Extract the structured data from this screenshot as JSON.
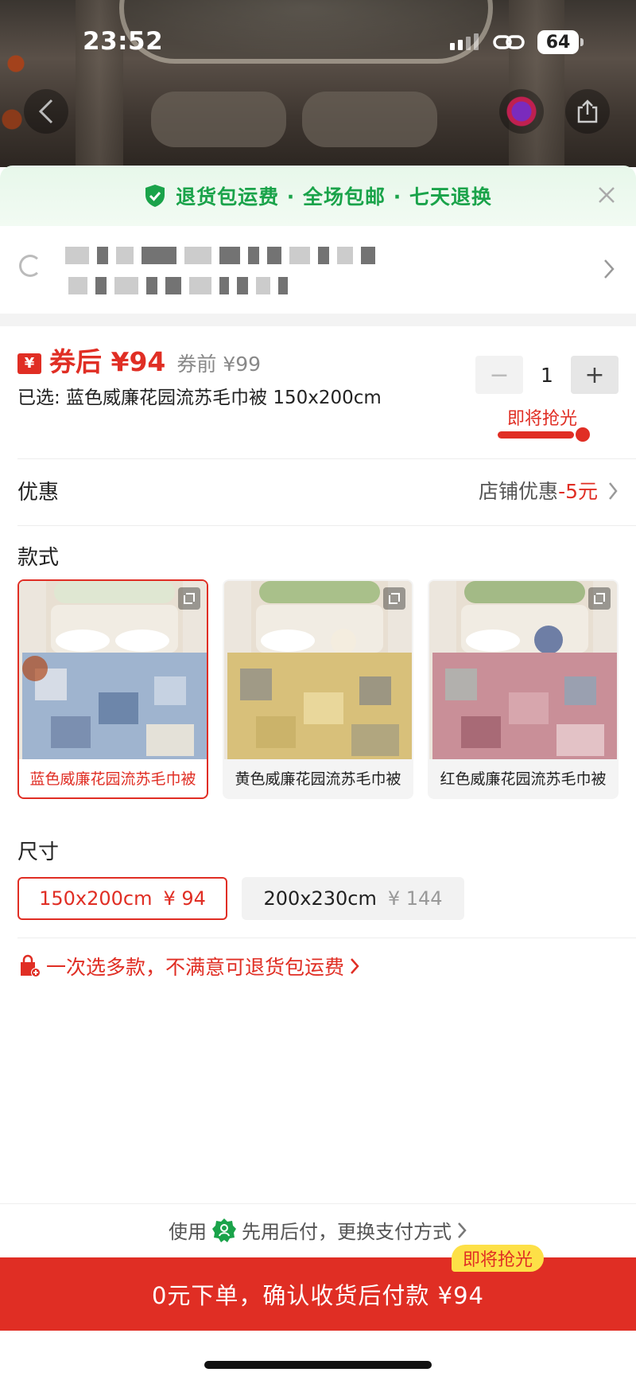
{
  "status_bar": {
    "time": "23:52",
    "battery": "64"
  },
  "banner": {
    "text": "退货包运费 · 全场包邮 · 七天退换"
  },
  "price": {
    "coupon_tag": "¥",
    "after_coupon": "券后 ¥94",
    "before_coupon": "券前 ¥99",
    "selected": "已选: 蓝色威廉花园流苏毛巾被 150x200cm"
  },
  "stepper": {
    "minus": "−",
    "value": "1",
    "plus": "+"
  },
  "stock": {
    "label": "即将抢光",
    "remaining_fraction": 0.8
  },
  "discount": {
    "label": "优惠",
    "shop_label": "店铺优惠",
    "amount": "-5元"
  },
  "style": {
    "title": "款式",
    "options": [
      {
        "label": "蓝色威廉花园流苏毛巾被",
        "selected": true,
        "quilt_color": "#9fb4cf"
      },
      {
        "label": "黄色威廉花园流苏毛巾被",
        "selected": false,
        "quilt_color": "#d8c07a"
      },
      {
        "label": "红色威廉花园流苏毛巾被",
        "selected": false,
        "quilt_color": "#c98f98"
      }
    ]
  },
  "size": {
    "title": "尺寸",
    "options": [
      {
        "label": "150x200cm",
        "price": "¥ 94",
        "selected": true
      },
      {
        "label": "200x230cm",
        "price": "¥ 144",
        "selected": false
      }
    ]
  },
  "multi_select": {
    "text": "一次选多款，不满意可退货包运费"
  },
  "pay_later": {
    "prefix": "使用",
    "suffix": "先用后付，更换支付方式"
  },
  "order": {
    "button": "0元下单，确认收货后付款 ¥94",
    "tag": "即将抢光"
  },
  "colors": {
    "accent": "#e02e24",
    "green": "#1aa34a",
    "tag_yellow": "#fde047"
  }
}
